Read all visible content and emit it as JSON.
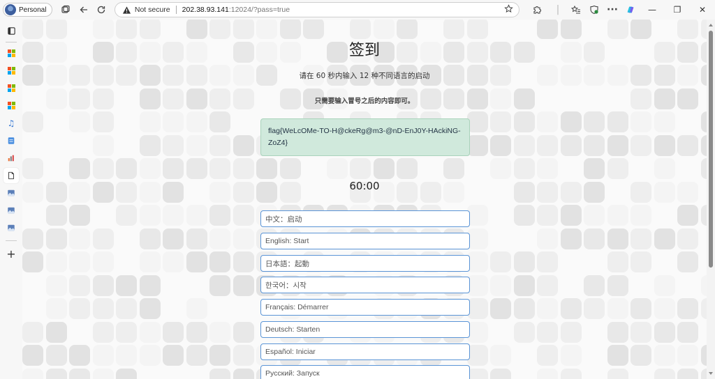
{
  "browser": {
    "profile_label": "Personal",
    "security_label": "Not secure",
    "url_host": "202.38.93.141",
    "url_path": ":12024/?pass=true"
  },
  "page": {
    "title": "签到",
    "instruction": "请在 60 秒内输入 12 种不同语言的启动",
    "hint": "只需要输入冒号之后的内容即可。",
    "flag": "flag{WeLcOMe-TO-H@ckeRg@m3-@nD-EnJ0Y-HAckiNG-ZoZ4}",
    "timer": "60:00",
    "inputs": [
      "中文：启动",
      "English: Start",
      "日本語：起動",
      "한국어：시작",
      "Français: Démarrer",
      "Deutsch: Starten",
      "Español: Iniciar",
      "Русский: Запуск"
    ]
  },
  "colors": {
    "flag_bg": "#d0e9dc",
    "input_border": "#5a94d6"
  }
}
